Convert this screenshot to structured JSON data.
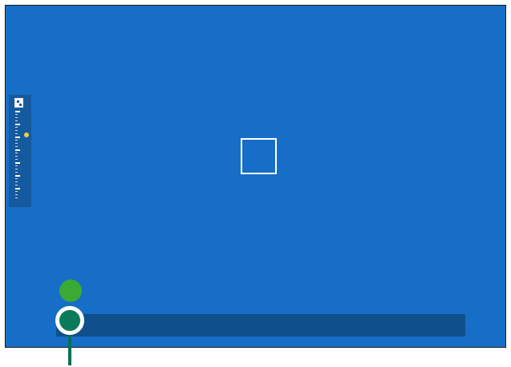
{
  "viewfinder": {
    "background_color": "#176ec6"
  },
  "exposure_scale": {
    "icon": "exposure-compensation-icon",
    "level": 0.27,
    "marker_color": "#f4d03f"
  },
  "focus_frame": {
    "icon": "focus-frame-icon"
  },
  "timeline": {
    "track_color": "#0e4f8c",
    "indicator_color": "#3aaa35",
    "pointer_color": "#0a7a5a",
    "position": 0.0
  }
}
